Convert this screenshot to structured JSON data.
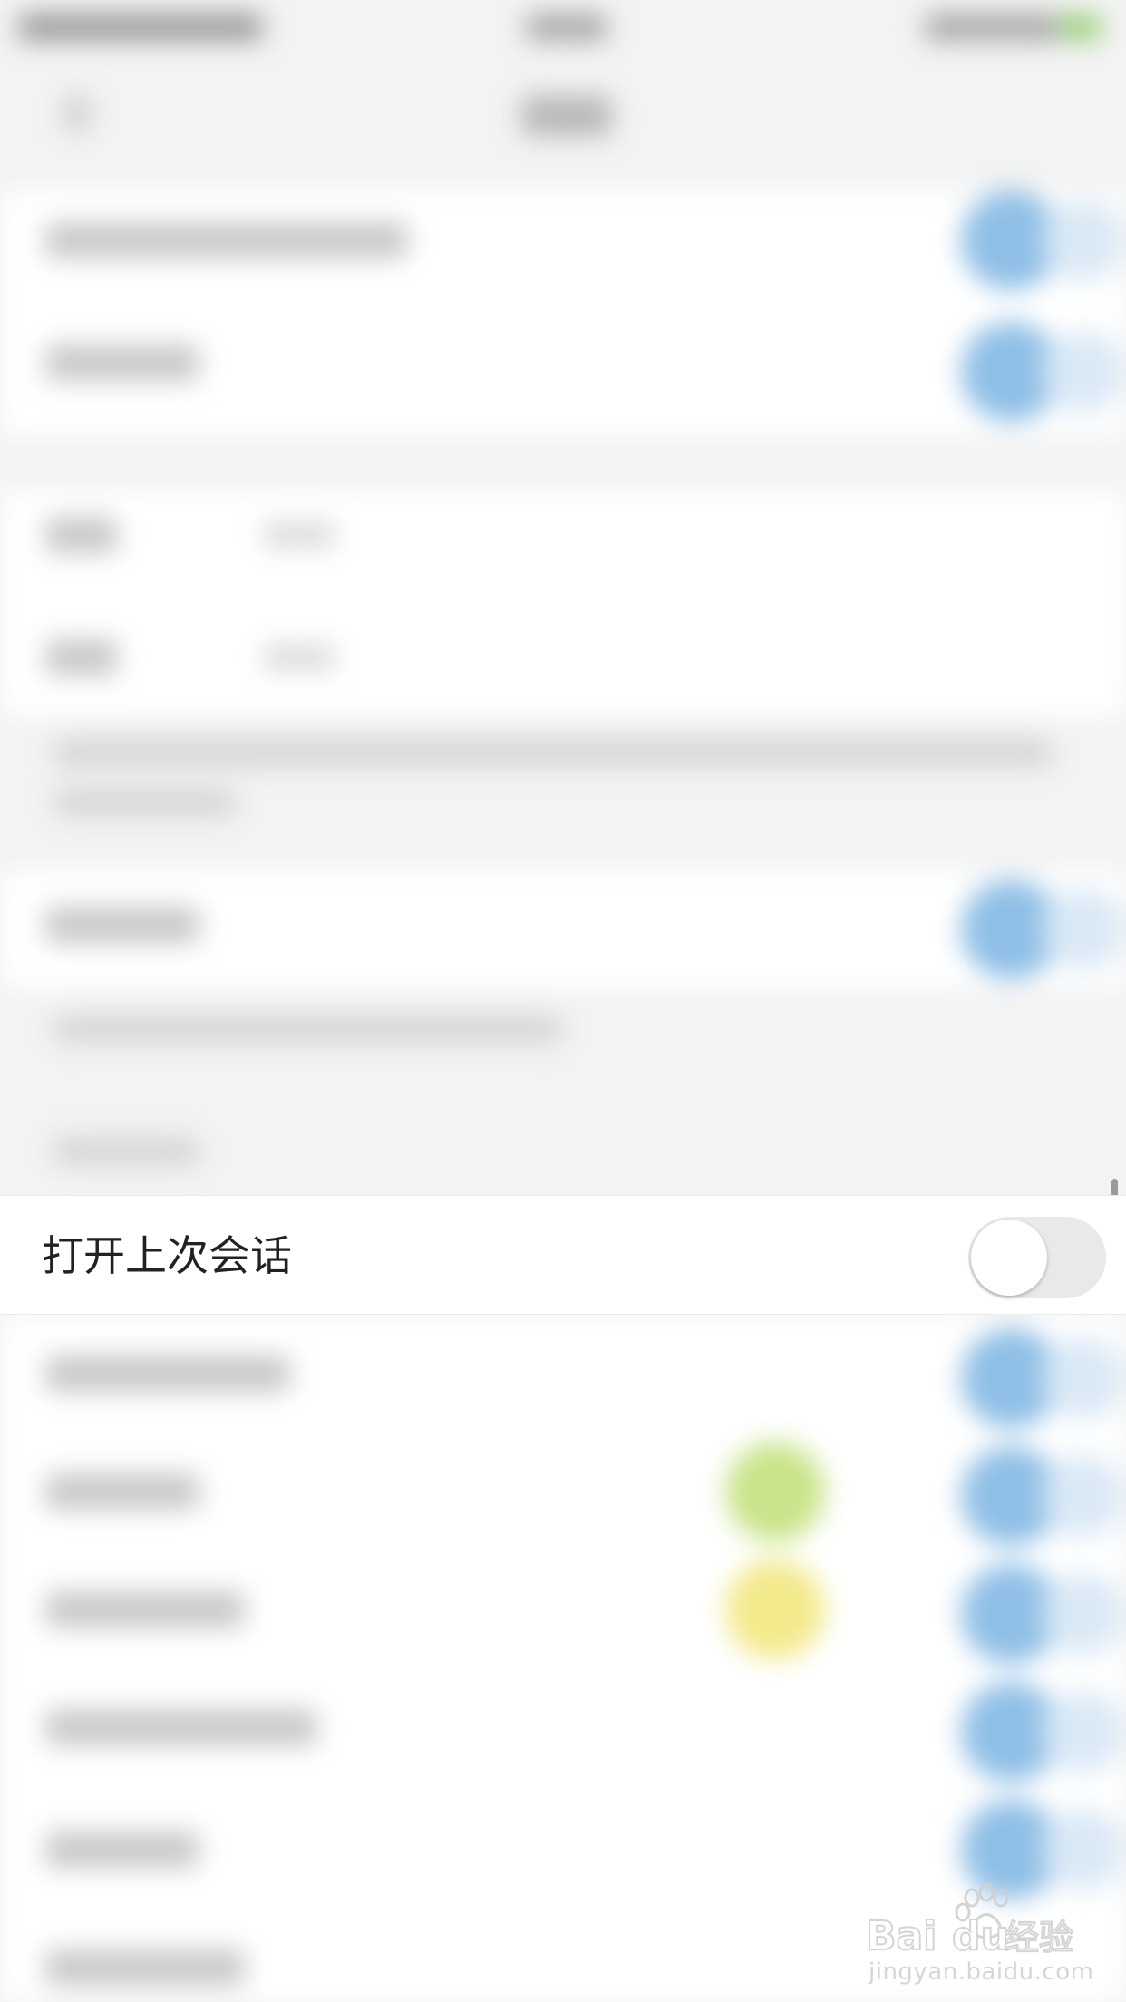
{
  "focus_row": {
    "label": "打开上次会话",
    "toggle_on": false
  },
  "colors": {
    "toggle_off_bg": "#e9e9e9",
    "blurred_toggle_blue": "#8fbfe6",
    "blurred_green": "#c9e48a",
    "blurred_yellow": "#f3ea8c"
  },
  "watermark": {
    "logo_text": "Baidu经验",
    "url": "jingyan.baidu.com"
  }
}
